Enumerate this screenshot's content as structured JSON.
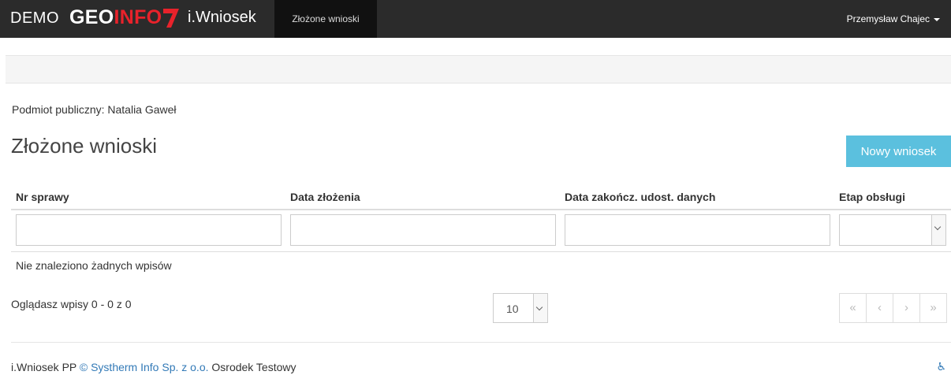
{
  "navbar": {
    "demo": "DEMO",
    "geo": "GEO",
    "info": "INFO",
    "app_name": "i.Wniosek",
    "active_tab": "Złożone wnioski",
    "user": "Przemysław Chajec"
  },
  "page": {
    "subject": "Podmiot publiczny: Natalia Gaweł",
    "title": "Złożone wnioski",
    "new_button": "Nowy wniosek"
  },
  "table": {
    "columns": [
      "Nr sprawy",
      "Data złożenia",
      "Data zakończ. udost. danych",
      "Etap obsługi"
    ],
    "filters": {
      "nr_sprawy": "",
      "data_zlozenia": "",
      "data_zakoncz": "",
      "etap": ""
    },
    "empty_message": "Nie znaleziono żadnych wpisów"
  },
  "pagination": {
    "info": "Oglądasz wpisy 0 - 0 z 0",
    "page_size": "10",
    "first": "«",
    "prev": "‹",
    "next": "›",
    "last": "»"
  },
  "footer": {
    "prefix": "i.Wniosek PP ",
    "company": "© Systherm Info Sp. z o.o.",
    "suffix": " Osrodek Testowy",
    "accessibility_icon": "accessibility-icon"
  },
  "colors": {
    "navbar": "#2b2b2b",
    "brand_red": "#e8222b",
    "info_button": "#5bc0de",
    "link": "#337ab7"
  }
}
